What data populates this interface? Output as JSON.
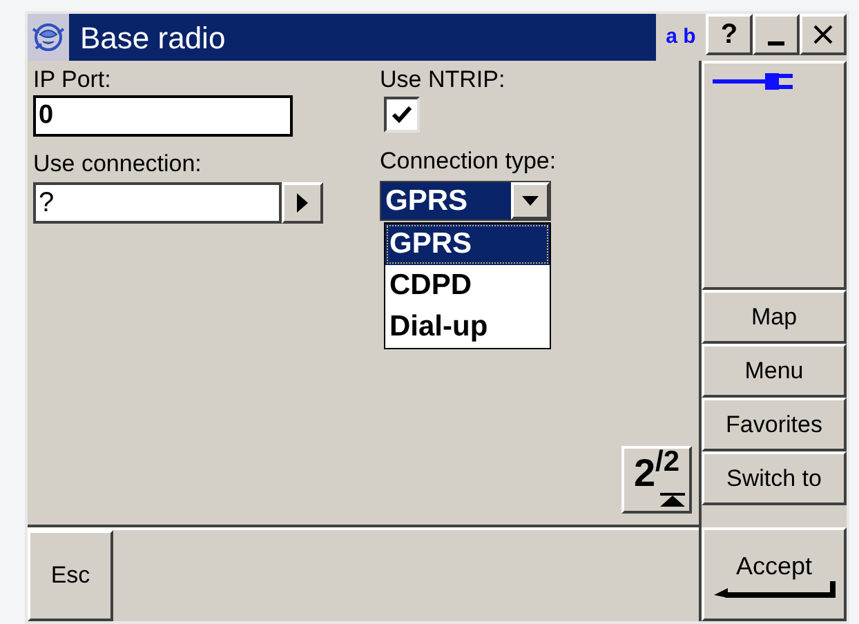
{
  "window": {
    "title": "Base radio",
    "input_mode": "a b"
  },
  "title_buttons": [
    {
      "kind": "help",
      "label": "?"
    },
    {
      "kind": "minimize"
    },
    {
      "kind": "close"
    }
  ],
  "form": {
    "ip_port": {
      "label": "IP Port:",
      "value": "0"
    },
    "use_ntrip": {
      "label": "Use NTRIP:",
      "checked": true
    },
    "use_connection": {
      "label": "Use connection:",
      "value": "?"
    },
    "connection_type": {
      "label": "Connection type:",
      "value": "GPRS",
      "expanded": true,
      "options": [
        {
          "label": "GPRS",
          "selected": true
        },
        {
          "label": "CDPD",
          "selected": false
        },
        {
          "label": "Dial-up",
          "selected": false
        }
      ]
    }
  },
  "page_indicator": "2$^{/2}$",
  "side_buttons": [
    {
      "label": "Map"
    },
    {
      "label": "Menu"
    },
    {
      "label": "Favorites"
    },
    {
      "label": "Switch to"
    }
  ],
  "bottom_buttons": {
    "left": "Esc",
    "right": "Accept"
  }
}
